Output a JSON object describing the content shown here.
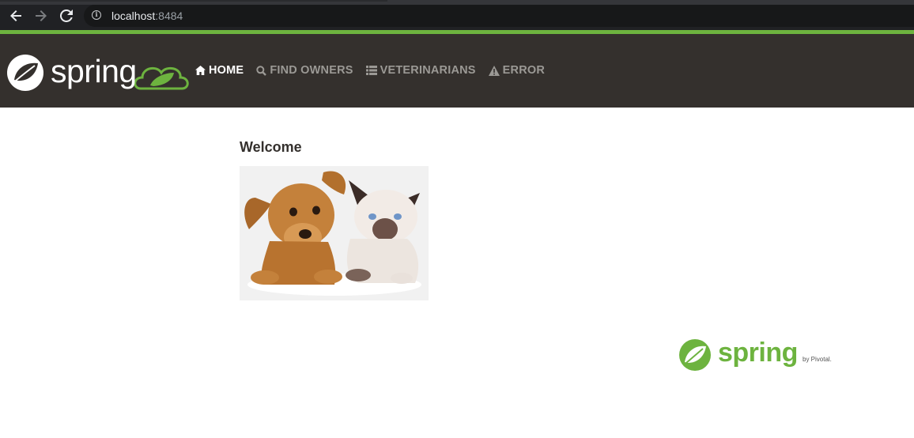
{
  "browser": {
    "url_host": "localhost",
    "url_port": ":8484",
    "icons": [
      "back-arrow-icon",
      "forward-arrow-icon",
      "reload-icon",
      "info-icon"
    ]
  },
  "navbar": {
    "brand_text": "spring",
    "items": [
      {
        "label": "HOME",
        "icon": "home-icon",
        "active": true
      },
      {
        "label": "FIND OWNERS",
        "icon": "search-icon",
        "active": false
      },
      {
        "label": "VETERINARIANS",
        "icon": "list-icon",
        "active": false
      },
      {
        "label": "ERROR",
        "icon": "warning-icon",
        "active": false
      }
    ]
  },
  "main": {
    "heading": "Welcome",
    "image_alt": "puppy and kitten"
  },
  "footer": {
    "brand_text": "spring",
    "by_text": "by Pivotal."
  },
  "colors": {
    "spring_green": "#6db33f",
    "navbar_bg": "#34302d",
    "browser_bg": "#202124"
  }
}
